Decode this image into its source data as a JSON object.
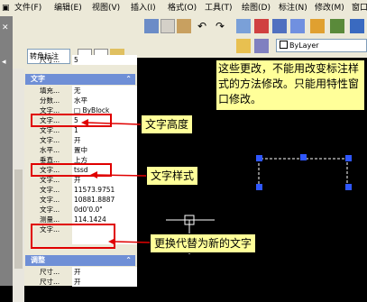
{
  "menubar": {
    "items": [
      "文件(F)",
      "编辑(E)",
      "视图(V)",
      "插入(I)",
      "格式(O)",
      "工具(T)",
      "绘图(D)",
      "标注(N)",
      "修改(M)",
      "窗口"
    ]
  },
  "toolbar": {
    "dim_style_select": "转角标注",
    "layer_value": "ByLayer"
  },
  "properties": {
    "size_label": "尺寸...",
    "size_value": "5",
    "text_section_title": "文字",
    "text_rows": [
      {
        "key": "填充...",
        "value": "无"
      },
      {
        "key": "分数...",
        "value": "水平"
      },
      {
        "key": "文字...",
        "value": "□ ByBlock"
      },
      {
        "key": "文字...",
        "value": "5"
      },
      {
        "key": "文字...",
        "value": "1"
      },
      {
        "key": "文字...",
        "value": "开"
      },
      {
        "key": "水平...",
        "value": "置中"
      },
      {
        "key": "垂直...",
        "value": "上方"
      },
      {
        "key": "文字...",
        "value": "tssd"
      },
      {
        "key": "文字...",
        "value": "开"
      },
      {
        "key": "文字...",
        "value": "11573.9751"
      },
      {
        "key": "文字...",
        "value": "10881.8887"
      },
      {
        "key": "文字...",
        "value": "0d0'0.0\""
      },
      {
        "key": "测量...",
        "value": "114.1424"
      },
      {
        "key": "文字...",
        "value": ""
      }
    ],
    "adjust_section_title": "调整",
    "adjust_rows": [
      {
        "key": "尺寸...",
        "value": "开"
      },
      {
        "key": "尺寸...",
        "value": "开"
      }
    ]
  },
  "annotations": {
    "note": "这些更改，不能用改变标注样式的方法修改。只能用特性窗口修改。",
    "text_height": "文字高度",
    "text_style": "文字样式",
    "override_text": "更换代替为新的文字"
  },
  "colors": {
    "accent": "#e00000",
    "note_bg": "#ffff99",
    "section_bg": "#6f8fd6",
    "grip": "#2f57ff"
  }
}
